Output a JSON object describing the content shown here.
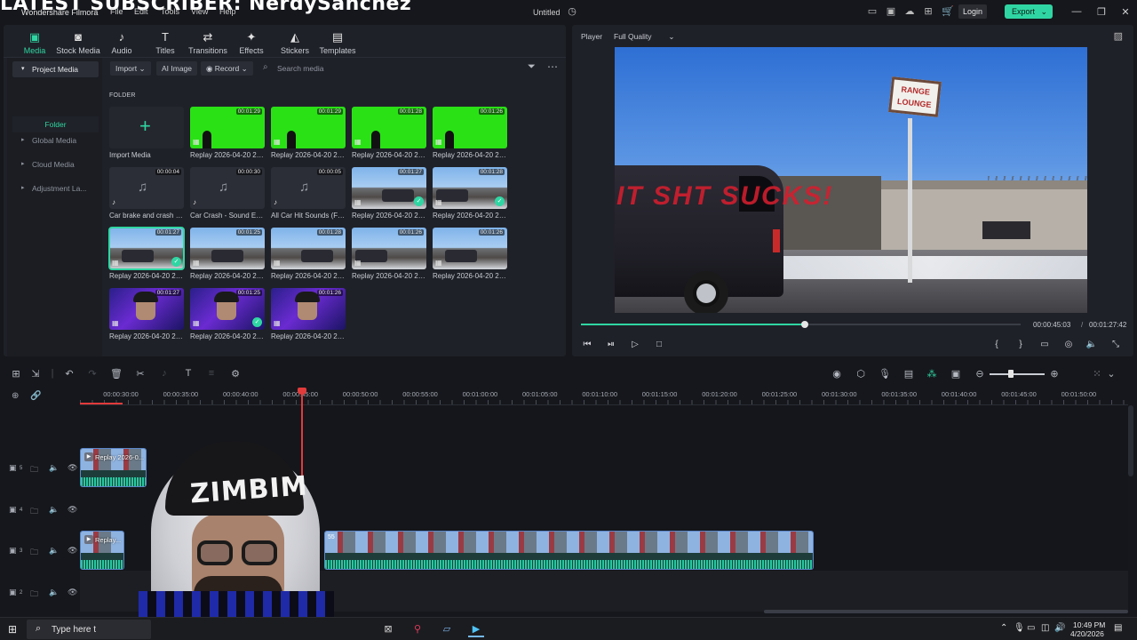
{
  "overlay": {
    "title": "LATEST SUBSCRIBER: NerdySanchez"
  },
  "titlebar": {
    "app_name": "Wondershare Filmora",
    "menu": [
      "File",
      "Edit",
      "Tools",
      "View",
      "Help"
    ],
    "document_title": "Untitled",
    "login_label": "Login",
    "export_label": "Export"
  },
  "toolbar_tabs": [
    {
      "label": "Media",
      "icon": "media-icon",
      "glyph": "▣"
    },
    {
      "label": "Stock Media",
      "icon": "stock-media-icon",
      "glyph": "◙"
    },
    {
      "label": "Audio",
      "icon": "audio-icon",
      "glyph": "♪"
    },
    {
      "label": "Titles",
      "icon": "titles-icon",
      "glyph": "T"
    },
    {
      "label": "Transitions",
      "icon": "transitions-icon",
      "glyph": "⇄"
    },
    {
      "label": "Effects",
      "icon": "effects-icon",
      "glyph": "✦"
    },
    {
      "label": "Stickers",
      "icon": "stickers-icon",
      "glyph": "◭"
    },
    {
      "label": "Templates",
      "icon": "templates-icon",
      "glyph": "▤"
    }
  ],
  "sidebar": {
    "items": [
      "Project Media",
      "Global Media",
      "Cloud Media",
      "Adjustment La..."
    ],
    "folder": "Folder"
  },
  "media_toolbar": {
    "import_label": "Import",
    "ai_image_label": "AI Image",
    "record_label": "Record",
    "search_placeholder": "Search media"
  },
  "media": {
    "folder_label": "FOLDER",
    "import_label": "Import Media",
    "clips": [
      {
        "name": "Replay 2026-04-20 22-...",
        "duration": "00:01:29",
        "kind": "green",
        "selected": false,
        "used": false
      },
      {
        "name": "Replay 2026-04-20 22-...",
        "duration": "00:01:29",
        "kind": "green",
        "selected": false,
        "used": false
      },
      {
        "name": "Replay 2026-04-20 22-...",
        "duration": "00:01:28",
        "kind": "green",
        "selected": false,
        "used": false
      },
      {
        "name": "Replay 2026-04-20 22-...",
        "duration": "00:01:26",
        "kind": "green",
        "selected": false,
        "used": false
      },
      {
        "name": "Car brake and crash S...",
        "duration": "00:00:04",
        "kind": "audio",
        "selected": false,
        "used": false
      },
      {
        "name": "Car Crash - Sound Eff...",
        "duration": "00:00:30",
        "kind": "audio",
        "selected": false,
        "used": false
      },
      {
        "name": "All Car Hit Sounds (Fo...",
        "duration": "00:00:05",
        "kind": "audio",
        "selected": false,
        "used": false
      },
      {
        "name": "Replay 2026-04-20 22-...",
        "duration": "00:01:27",
        "kind": "scene",
        "selected": false,
        "used": true
      },
      {
        "name": "Replay 2026-04-20 22-...",
        "duration": "00:01:28",
        "kind": "scene",
        "selected": false,
        "used": true
      },
      {
        "name": "Replay 2026-04-20 22-...",
        "duration": "00:01:27",
        "kind": "scene",
        "selected": true,
        "used": true
      },
      {
        "name": "Replay 2026-04-20 22-...",
        "duration": "00:01:25",
        "kind": "scene",
        "selected": false,
        "used": false
      },
      {
        "name": "Replay 2026-04-20 22-...",
        "duration": "00:01:28",
        "kind": "scene",
        "selected": false,
        "used": false
      },
      {
        "name": "Replay 2026-04-20 22-...",
        "duration": "00:01:26",
        "kind": "scene",
        "selected": false,
        "used": false
      },
      {
        "name": "Replay 2026-04-20 22-...",
        "duration": "00:01:26",
        "kind": "scene",
        "selected": false,
        "used": false
      },
      {
        "name": "Replay 2026-04-20 21-...",
        "duration": "00:01:27",
        "kind": "face",
        "selected": false,
        "used": false
      },
      {
        "name": "Replay 2026-04-20 21-...",
        "duration": "00:01:25",
        "kind": "face",
        "selected": false,
        "used": true
      },
      {
        "name": "Replay 2026-04-20 21-...",
        "duration": "00:01:26",
        "kind": "face",
        "selected": false,
        "used": false
      }
    ]
  },
  "player": {
    "label": "Player",
    "quality": "Full Quality",
    "sign_text": "RANGE LOUNGE",
    "van_text": "IT SHT SUCKS!",
    "current_time": "00:00:45:03",
    "separator": "/",
    "total_time": "00:01:27:42",
    "progress": 0.51
  },
  "timeline": {
    "ruler_labels": [
      "00:00:30:00",
      "00:00:35:00",
      "00:00:40:00",
      "00:00:45:00",
      "00:00:50:00",
      "00:00:55:00",
      "00:01:00:00",
      "00:01:05:00",
      "00:01:10:00",
      "00:01:15:00",
      "00:01:20:00",
      "00:01:25:00",
      "00:01:30:00",
      "00:01:35:00",
      "00:01:40:00",
      "00:01:45:00",
      "00:01:50:00"
    ],
    "tracks": [
      "5",
      "4",
      "3",
      "2"
    ],
    "clips": [
      {
        "label": "Replay 2026-0..."
      },
      {
        "label": "Replay..."
      }
    ],
    "clip_tag": "55"
  },
  "webcam": {
    "cap_text": "ZIMBIM"
  },
  "taskbar": {
    "search_placeholder": "Type here t",
    "time": "10:49 PM",
    "date": "4/20/2026"
  },
  "colors": {
    "accent": "#2fd6a3",
    "playhead": "#e23b3b",
    "chroma_green": "#2ae116"
  }
}
